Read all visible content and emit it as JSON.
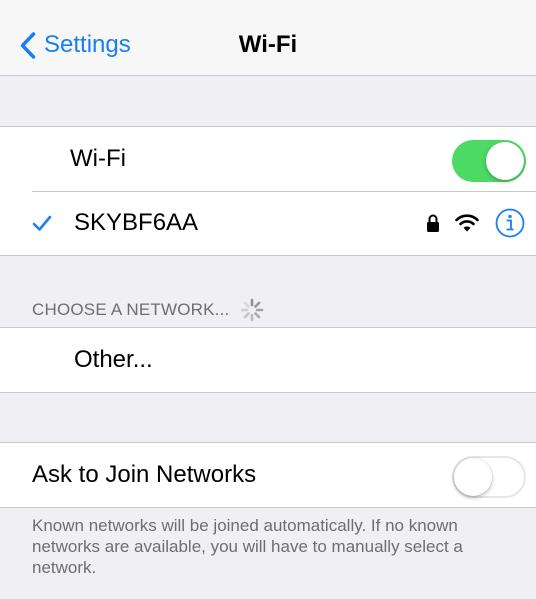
{
  "nav": {
    "back_label": "Settings",
    "title": "Wi-Fi"
  },
  "wifi_toggle": {
    "label": "Wi-Fi",
    "state": "on"
  },
  "connected_network": {
    "name": "SKYBF6AA",
    "secured": true,
    "icons": [
      "checkmark-icon",
      "lock-icon",
      "wifi-signal-icon",
      "info-icon"
    ]
  },
  "choose_section": {
    "header": "CHOOSE A NETWORK...",
    "other_label": "Other..."
  },
  "ask_to_join": {
    "label": "Ask to Join Networks",
    "state": "off",
    "footer": "Known networks will be joined automatically. If no known networks are available, you will have to manually select a network."
  },
  "colors": {
    "accent": "#1a7ef3",
    "toggle_on": "#4cd964",
    "background": "#efeff4",
    "secondary_text": "#6d6d72"
  }
}
